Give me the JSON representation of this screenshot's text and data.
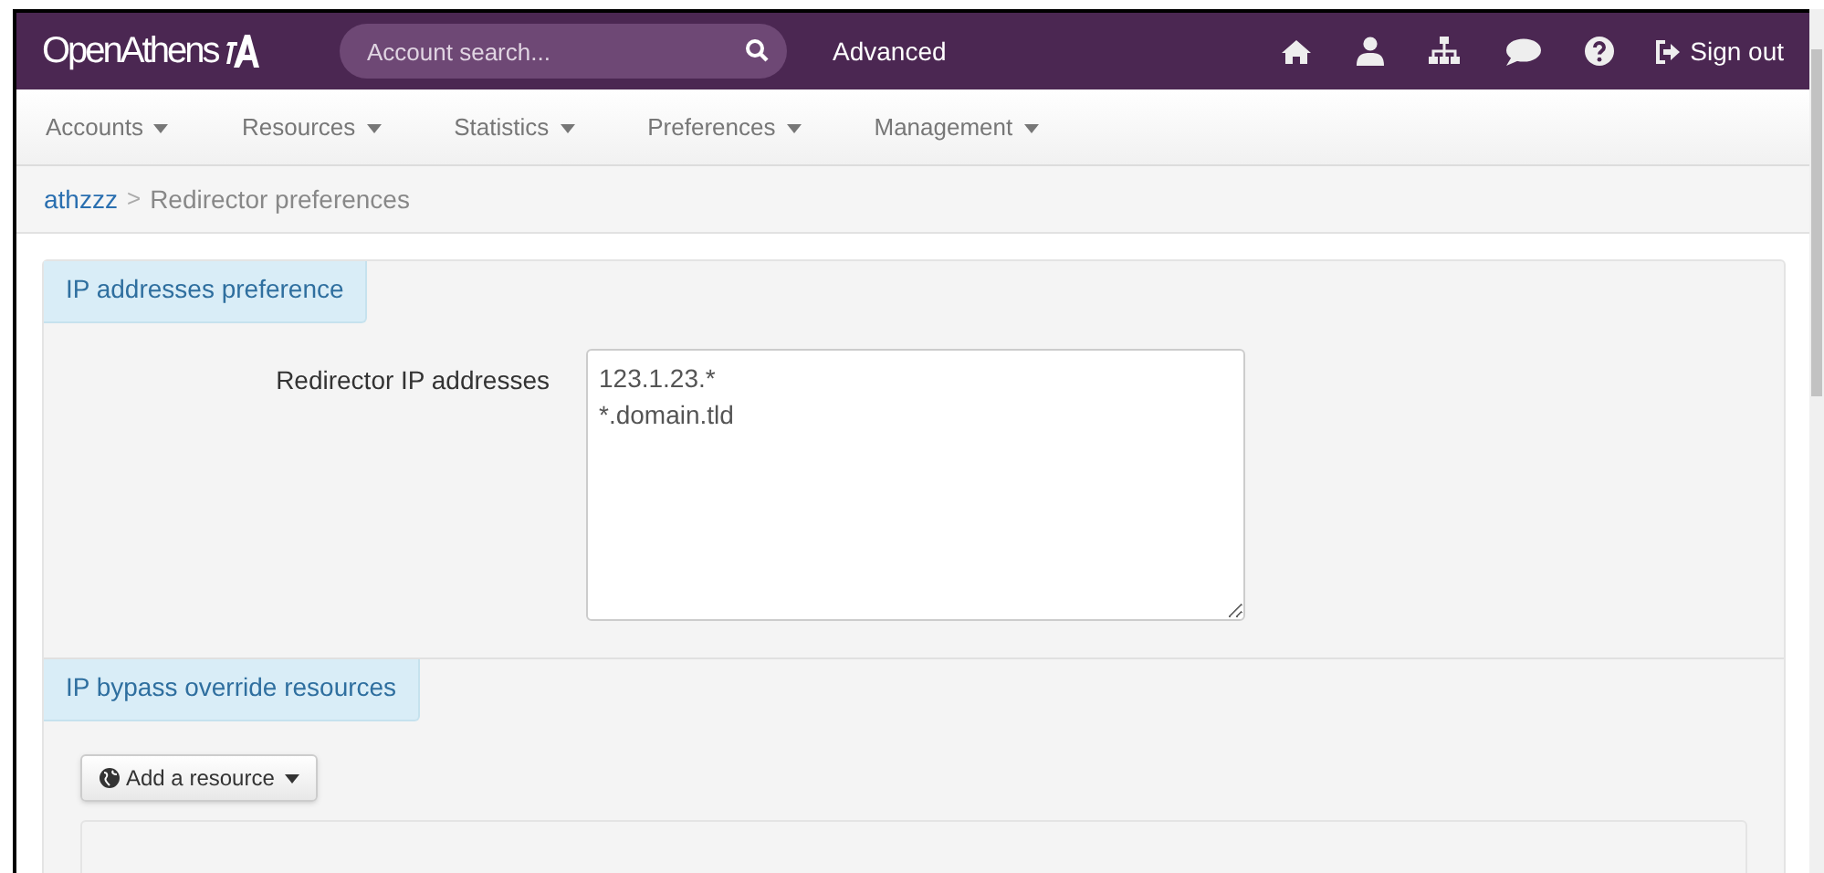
{
  "header": {
    "logo": "OpenAthens",
    "search": {
      "placeholder": "Account search..."
    },
    "advanced": "Advanced",
    "icons": [
      {
        "kind": "home"
      },
      {
        "kind": "user"
      },
      {
        "kind": "sitemap"
      },
      {
        "kind": "chat"
      },
      {
        "kind": "help"
      }
    ],
    "sign_out": "Sign out"
  },
  "menu": [
    {
      "label": "Accounts"
    },
    {
      "label": "Resources"
    },
    {
      "label": "Statistics"
    },
    {
      "label": "Preferences"
    },
    {
      "label": "Management"
    }
  ],
  "breadcrumb": [
    {
      "label": "athzzz",
      "kind": "link"
    },
    {
      "label": ">",
      "kind": "separator"
    },
    {
      "label": "Redirector preferences",
      "kind": "current"
    }
  ],
  "sections": [
    {
      "title": "IP addresses preference",
      "field": {
        "label": "Redirector IP addresses",
        "lines": [
          "123.1.23.*",
          "*.domain.tld"
        ]
      }
    },
    {
      "title": "IP bypass override resources",
      "button": "Add a resource"
    }
  ]
}
